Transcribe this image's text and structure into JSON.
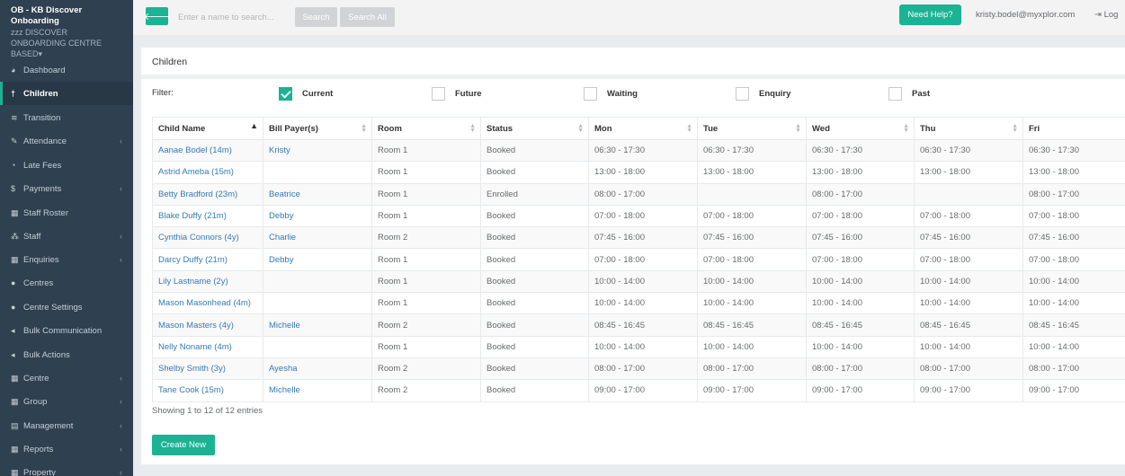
{
  "sidebar": {
    "org_name": "OB - KB Discover Onboarding",
    "centre_name": "zzz DISCOVER ONBOARDING CENTRE BASED",
    "items": [
      {
        "label": "Dashboard",
        "icon": "◕",
        "chev": ""
      },
      {
        "label": "Children",
        "icon": "†",
        "chev": ""
      },
      {
        "label": "Transition",
        "icon": "≋",
        "chev": ""
      },
      {
        "label": "Attendance",
        "icon": "✎",
        "chev": "‹"
      },
      {
        "label": "Late Fees",
        "icon": "◔",
        "chev": ""
      },
      {
        "label": "Payments",
        "icon": "$",
        "chev": "‹"
      },
      {
        "label": "Staff Roster",
        "icon": "▦",
        "chev": ""
      },
      {
        "label": "Staff",
        "icon": "⁂",
        "chev": "‹"
      },
      {
        "label": "Enquiries",
        "icon": "▦",
        "chev": "‹"
      },
      {
        "label": "Centres",
        "icon": "●",
        "chev": ""
      },
      {
        "label": "Centre Settings",
        "icon": "●",
        "chev": ""
      },
      {
        "label": "Bulk Communication",
        "icon": "◂",
        "chev": ""
      },
      {
        "label": "Bulk Actions",
        "icon": "◂",
        "chev": ""
      },
      {
        "label": "Centre",
        "icon": "▦",
        "chev": "‹"
      },
      {
        "label": "Group",
        "icon": "▦",
        "chev": "‹"
      },
      {
        "label": "Management",
        "icon": "▤",
        "chev": "‹"
      },
      {
        "label": "Reports",
        "icon": "▦",
        "chev": "‹"
      },
      {
        "label": "Property",
        "icon": "▦",
        "chev": "‹"
      }
    ]
  },
  "topbar": {
    "search_placeholder": "Enter a name to search...",
    "search_label": "Search",
    "search_all_label": "Search All",
    "help_label": "Need Help?",
    "user_email": "kristy.bodel@myxplor.com",
    "logout_label": "⇥ Log"
  },
  "page": {
    "title": "Children",
    "filter_label": "Filter:",
    "filters": [
      {
        "label": "Current",
        "checked": true
      },
      {
        "label": "Future",
        "checked": false
      },
      {
        "label": "Waiting",
        "checked": false
      },
      {
        "label": "Enquiry",
        "checked": false
      },
      {
        "label": "Past",
        "checked": false
      }
    ],
    "showing": "Showing 1 to 12 of 12 entries",
    "create_label": "Create New"
  },
  "table": {
    "columns": [
      "Child Name",
      "Bill Payer(s)",
      "Room",
      "Status",
      "Mon",
      "Tue",
      "Wed",
      "Thu",
      "Fri"
    ],
    "rows": [
      [
        "Aanae Bodel (14m)",
        "Kristy",
        "Room 1",
        "Booked",
        "06:30 - 17:30",
        "06:30 - 17:30",
        "06:30 - 17:30",
        "06:30 - 17:30",
        "06:30 - 17:30"
      ],
      [
        "Astrid Ameba (15m)",
        "",
        "Room 1",
        "Booked",
        "13:00 - 18:00",
        "13:00 - 18:00",
        "13:00 - 18:00",
        "13:00 - 18:00",
        "13:00 - 18:00"
      ],
      [
        "Betty Bradford (23m)",
        "Beatrice",
        "Room 1",
        "Enrolled",
        "08:00 - 17:00",
        "",
        "08:00 - 17:00",
        "",
        "08:00 - 17:00"
      ],
      [
        "Blake Duffy (21m)",
        "Debby",
        "Room 1",
        "Booked",
        "07:00 - 18:00",
        "07:00 - 18:00",
        "07:00 - 18:00",
        "07:00 - 18:00",
        "07:00 - 18:00"
      ],
      [
        "Cynthia Connors (4y)",
        "Charlie",
        "Room 2",
        "Booked",
        "07:45 - 16:00",
        "07:45 - 16:00",
        "07:45 - 16:00",
        "07:45 - 16:00",
        "07:45 - 16:00"
      ],
      [
        "Darcy Duffy (21m)",
        "Debby",
        "Room 1",
        "Booked",
        "07:00 - 18:00",
        "07:00 - 18:00",
        "07:00 - 18:00",
        "07:00 - 18:00",
        "07:00 - 18:00"
      ],
      [
        "Lily Lastname (2y)",
        "",
        "Room 1",
        "Booked",
        "10:00 - 14:00",
        "10:00 - 14:00",
        "10:00 - 14:00",
        "10:00 - 14:00",
        "10:00 - 14:00"
      ],
      [
        "Mason Masonhead (4m)",
        "",
        "Room 1",
        "Booked",
        "10:00 - 14:00",
        "10:00 - 14:00",
        "10:00 - 14:00",
        "10:00 - 14:00",
        "10:00 - 14:00"
      ],
      [
        "Mason Masters (4y)",
        "Michelle",
        "Room 2",
        "Booked",
        "08:45 - 16:45",
        "08:45 - 16:45",
        "08:45 - 16:45",
        "08:45 - 16:45",
        "08:45 - 16:45"
      ],
      [
        "Nelly Noname (4m)",
        "",
        "Room 1",
        "Booked",
        "10:00 - 14:00",
        "10:00 - 14:00",
        "10:00 - 14:00",
        "10:00 - 14:00",
        "10:00 - 14:00"
      ],
      [
        "Shelby Smith (3y)",
        "Ayesha",
        "Room 2",
        "Booked",
        "08:00 - 17:00",
        "08:00 - 17:00",
        "08:00 - 17:00",
        "08:00 - 17:00",
        "08:00 - 17:00"
      ],
      [
        "Tane Cook (15m)",
        "Michelle",
        "Room 2",
        "Booked",
        "09:00 - 17:00",
        "09:00 - 17:00",
        "09:00 - 17:00",
        "09:00 - 17:00",
        "09:00 - 17:00"
      ]
    ]
  }
}
